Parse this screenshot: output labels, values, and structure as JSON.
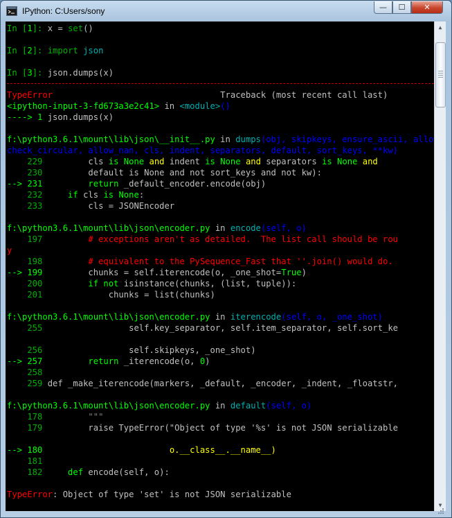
{
  "window": {
    "title": "IPython: C:Users/sony",
    "buttons": {
      "minimize": "—",
      "maximize": "☐",
      "close": "✕"
    }
  },
  "colors": {
    "background": "#000000",
    "default_text": "#c0c0c0",
    "prompt_green": "#00c000",
    "bright_green": "#00ff00",
    "number_green": "#00b000",
    "red": "#ff0000",
    "yellow": "#ffff00",
    "blue": "#0000ff",
    "cyan": "#00b0b0",
    "gray": "#808080"
  },
  "console_lines": [
    [
      {
        "t": "In [",
        "c": "prompt_green"
      },
      {
        "t": "1",
        "c": "bright_green"
      },
      {
        "t": "]: ",
        "c": "prompt_green"
      },
      {
        "t": "x = ",
        "c": "default_text"
      },
      {
        "t": "set",
        "c": "number_green"
      },
      {
        "t": "()",
        "c": "default_text"
      }
    ],
    [],
    [
      {
        "t": "In [",
        "c": "prompt_green"
      },
      {
        "t": "2",
        "c": "bright_green"
      },
      {
        "t": "]: ",
        "c": "prompt_green"
      },
      {
        "t": "import",
        "c": "number_green"
      },
      {
        "t": " ",
        "c": "default_text"
      },
      {
        "t": "json",
        "c": "cyan"
      }
    ],
    [],
    [
      {
        "t": "In [",
        "c": "prompt_green"
      },
      {
        "t": "3",
        "c": "bright_green"
      },
      {
        "t": "]: ",
        "c": "prompt_green"
      },
      {
        "t": "json.dumps(x)",
        "c": "default_text"
      }
    ],
    [
      {
        "t": "",
        "c": "red",
        "sep": true
      }
    ],
    [
      {
        "t": "TypeError",
        "c": "red"
      },
      {
        "t": "                                 Traceback (most recent call last)",
        "c": "default_text"
      }
    ],
    [
      {
        "t": "<ipython-input-3-fd673a3e2c41>",
        "c": "bright_green"
      },
      {
        "t": " in ",
        "c": "default_text"
      },
      {
        "t": "<module>",
        "c": "cyan"
      },
      {
        "t": "()",
        "c": "blue"
      }
    ],
    [
      {
        "t": "----> 1 ",
        "c": "bright_green"
      },
      {
        "t": "json.dumps(x)",
        "c": "default_text"
      }
    ],
    [],
    [
      {
        "t": "f:\\python3.6.1\\mount\\lib\\json\\__init__.py",
        "c": "bright_green"
      },
      {
        "t": " in ",
        "c": "default_text"
      },
      {
        "t": "dumps",
        "c": "cyan"
      },
      {
        "t": "(obj, skipkeys, ensure_ascii, allow_nan, cls, indent, separators, default, sort_keys, **kw)",
        "c": "blue"
      }
    ],
    [
      {
        "t": "check_circular, allow_nan, cls, indent, separators, default, sort_keys, **kw)",
        "c": "blue"
      }
    ],
    [
      {
        "t": "    229 ",
        "c": "number_green"
      },
      {
        "t": "        cls ",
        "c": "default_text"
      },
      {
        "t": "is",
        "c": "bright_green"
      },
      {
        "t": " ",
        "c": "default_text"
      },
      {
        "t": "None",
        "c": "bright_green"
      },
      {
        "t": " and ",
        "c": "yellow"
      },
      {
        "t": "indent ",
        "c": "default_text"
      },
      {
        "t": "is",
        "c": "bright_green"
      },
      {
        "t": " ",
        "c": "default_text"
      },
      {
        "t": "None",
        "c": "bright_green"
      },
      {
        "t": " and ",
        "c": "yellow"
      },
      {
        "t": "separators ",
        "c": "default_text"
      },
      {
        "t": "is",
        "c": "bright_green"
      },
      {
        "t": " ",
        "c": "default_text"
      },
      {
        "t": "None",
        "c": "bright_green"
      },
      {
        "t": " and",
        "c": "yellow"
      }
    ],
    [
      {
        "t": "    230 ",
        "c": "number_green"
      },
      {
        "t": "        default is None and not sort_keys and not kw):",
        "c": "default_text"
      }
    ],
    [
      {
        "t": "--> 231 ",
        "c": "bright_green"
      },
      {
        "t": "        return ",
        "c": "bright_green"
      },
      {
        "t": "_default_encoder.encode(obj)",
        "c": "default_text"
      }
    ],
    [
      {
        "t": "    232 ",
        "c": "number_green"
      },
      {
        "t": "    if ",
        "c": "bright_green"
      },
      {
        "t": "cls ",
        "c": "default_text"
      },
      {
        "t": "is",
        "c": "bright_green"
      },
      {
        "t": " ",
        "c": "default_text"
      },
      {
        "t": "None",
        "c": "bright_green"
      },
      {
        "t": ":",
        "c": "default_text"
      }
    ],
    [
      {
        "t": "    233 ",
        "c": "number_green"
      },
      {
        "t": "        cls = JSONEncoder",
        "c": "default_text"
      }
    ],
    [],
    [
      {
        "t": "f:\\python3.6.1\\mount\\lib\\json\\encoder.py",
        "c": "bright_green"
      },
      {
        "t": " in ",
        "c": "default_text"
      },
      {
        "t": "encode",
        "c": "cyan"
      },
      {
        "t": "(self, o)",
        "c": "blue"
      }
    ],
    [
      {
        "t": "    197 ",
        "c": "number_green"
      },
      {
        "t": "        # exceptions aren't as detailed.  The list call should be rou",
        "c": "red"
      }
    ],
    [
      {
        "t": "y",
        "c": "red"
      }
    ],
    [
      {
        "t": "    198 ",
        "c": "number_green"
      },
      {
        "t": "        # equivalent to the PySequence_Fast that ''.join() would do.",
        "c": "red"
      }
    ],
    [
      {
        "t": "--> 199 ",
        "c": "bright_green"
      },
      {
        "t": "        chunks = self.iterencode(o, _one_shot=",
        "c": "default_text"
      },
      {
        "t": "True",
        "c": "bright_green"
      },
      {
        "t": ")",
        "c": "default_text"
      }
    ],
    [
      {
        "t": "    200 ",
        "c": "number_green"
      },
      {
        "t": "        if not ",
        "c": "bright_green"
      },
      {
        "t": "isinstance(chunks, (list, tuple)):",
        "c": "default_text"
      }
    ],
    [
      {
        "t": "    201 ",
        "c": "number_green"
      },
      {
        "t": "            chunks = list(chunks)",
        "c": "default_text"
      }
    ],
    [],
    [
      {
        "t": "f:\\python3.6.1\\mount\\lib\\json\\encoder.py",
        "c": "bright_green"
      },
      {
        "t": " in ",
        "c": "default_text"
      },
      {
        "t": "iterencode",
        "c": "cyan"
      },
      {
        "t": "(self, o, _one_shot)",
        "c": "blue"
      }
    ],
    [
      {
        "t": "    255 ",
        "c": "number_green"
      },
      {
        "t": "                self.key_separator, self.item_separator, self.sort_ke",
        "c": "default_text"
      }
    ],
    [],
    [
      {
        "t": "    256 ",
        "c": "number_green"
      },
      {
        "t": "                self.skipkeys, _one_shot)",
        "c": "default_text"
      }
    ],
    [
      {
        "t": "--> 257 ",
        "c": "bright_green"
      },
      {
        "t": "        return ",
        "c": "bright_green"
      },
      {
        "t": "_iterencode(o, ",
        "c": "default_text"
      },
      {
        "t": "0",
        "c": "bright_green"
      },
      {
        "t": ")",
        "c": "default_text"
      }
    ],
    [
      {
        "t": "    258 ",
        "c": "number_green"
      }
    ],
    [
      {
        "t": "    259 ",
        "c": "number_green"
      },
      {
        "t": "def _make_iterencode(markers, _default, _encoder, _indent, _floatstr,",
        "c": "default_text"
      }
    ],
    [],
    [
      {
        "t": "f:\\python3.6.1\\mount\\lib\\json\\encoder.py",
        "c": "bright_green"
      },
      {
        "t": " in ",
        "c": "default_text"
      },
      {
        "t": "default",
        "c": "cyan"
      },
      {
        "t": "(self, o)",
        "c": "blue"
      }
    ],
    [
      {
        "t": "    178 ",
        "c": "number_green"
      },
      {
        "t": "        \"\"\"",
        "c": "gray"
      }
    ],
    [
      {
        "t": "    179 ",
        "c": "number_green"
      },
      {
        "t": "        raise TypeError(\"Object of type '%s' is not JSON serializable",
        "c": "default_text"
      }
    ],
    [],
    [
      {
        "t": "--> 180 ",
        "c": "bright_green"
      },
      {
        "t": "                        ",
        "c": "default_text"
      },
      {
        "t": "o.__class__.__name__)",
        "c": "yellow"
      }
    ],
    [
      {
        "t": "    181 ",
        "c": "number_green"
      }
    ],
    [
      {
        "t": "    182 ",
        "c": "number_green"
      },
      {
        "t": "    def ",
        "c": "bright_green"
      },
      {
        "t": "encode(self, o):",
        "c": "default_text"
      }
    ],
    [],
    [
      {
        "t": "TypeError",
        "c": "red"
      },
      {
        "t": ": Object of type 'set' is not JSON serializable",
        "c": "default_text"
      }
    ]
  ]
}
